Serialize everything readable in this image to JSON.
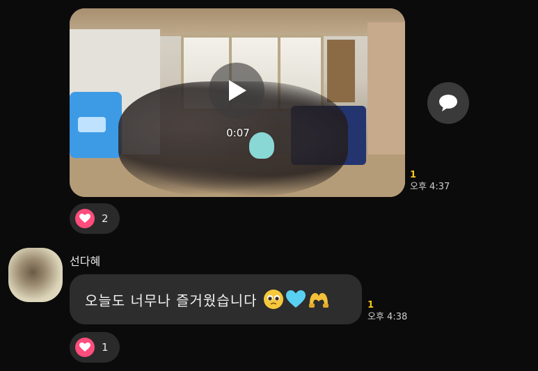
{
  "messages": [
    {
      "type": "video",
      "duration": "0:07",
      "unread_count": "1",
      "time": "오후 4:37",
      "reaction": {
        "icon": "heart-icon",
        "count": "2"
      }
    },
    {
      "type": "text",
      "sender": "선다혜",
      "text": "오늘도 너무나 즐거웠습니다",
      "emojis": [
        "pleading-face-icon",
        "light-blue-heart-icon",
        "heart-hands-icon"
      ],
      "unread_count": "1",
      "time": "오후 4:38",
      "reaction": {
        "icon": "heart-icon",
        "count": "1"
      }
    }
  ],
  "colors": {
    "background": "#0b0b0b",
    "bubble": "#2d2d2d",
    "unread": "#f5c518",
    "heart": "#ff4d7d"
  }
}
